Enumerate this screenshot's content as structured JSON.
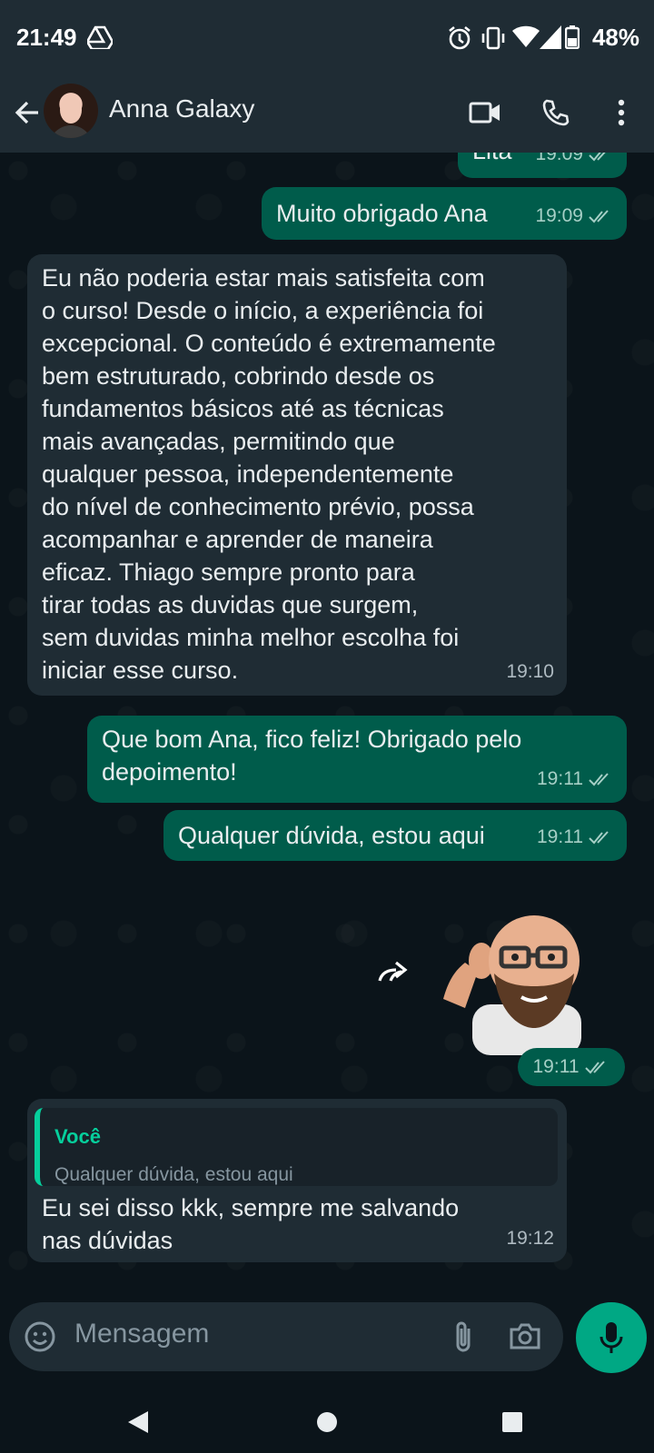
{
  "status_bar": {
    "time": "21:49",
    "battery": "48%",
    "icons": [
      "drive-icon",
      "alarm-icon",
      "vibrate-icon",
      "wifi-icon",
      "signal-icon",
      "battery-icon"
    ]
  },
  "header": {
    "contact_name": "Anna Galaxy",
    "icons": [
      "back-arrow-icon",
      "video-call-icon",
      "voice-call-icon",
      "more-options-icon"
    ]
  },
  "messages": [
    {
      "id": "m0",
      "direction": "out",
      "text": "Lita",
      "time": "19:09",
      "status": "read",
      "partially_visible": true
    },
    {
      "id": "m1",
      "direction": "out",
      "text": "Muito obrigado Ana",
      "time": "19:09",
      "status": "read"
    },
    {
      "id": "m2",
      "direction": "in",
      "text": "Eu não poderia estar mais satisfeita com\no curso! Desde o início, a experiência foi\nexcepcional. O conteúdo é extremamente\nbem estruturado, cobrindo desde os\nfundamentos básicos até as técnicas\nmais avançadas, permitindo que\nqualquer pessoa, independentemente\ndo nível de conhecimento prévio, possa\nacompanhar e aprender de maneira\neficaz. Thiago sempre pronto para\ntirar todas as duvidas que surgem,\nsem duvidas minha melhor escolha foi\niniciar esse curso.",
      "time": "19:10"
    },
    {
      "id": "m3",
      "direction": "out",
      "text": "Que bom Ana, fico feliz! Obrigado pelo\ndepoimento!",
      "time": "19:11",
      "status": "read"
    },
    {
      "id": "m4",
      "direction": "out",
      "text": "Qualquer dúvida, estou aqui",
      "time": "19:11",
      "status": "read"
    },
    {
      "id": "m5",
      "direction": "out",
      "type": "sticker",
      "time": "19:11",
      "status": "read"
    },
    {
      "id": "m6",
      "direction": "in",
      "quote": {
        "author": "Você",
        "text": "Qualquer dúvida, estou aqui"
      },
      "text": "Eu sei disso kkk, sempre me salvando\nnas dúvidas",
      "time": "19:12"
    }
  ],
  "composer": {
    "placeholder": "Mensagem",
    "icons": [
      "emoji-icon",
      "attach-icon",
      "camera-icon",
      "mic-icon"
    ]
  },
  "colors": {
    "outgoing_bubble": "#005c4b",
    "incoming_bubble": "#1f2c34",
    "accent": "#00a884",
    "background": "#0b141a"
  }
}
